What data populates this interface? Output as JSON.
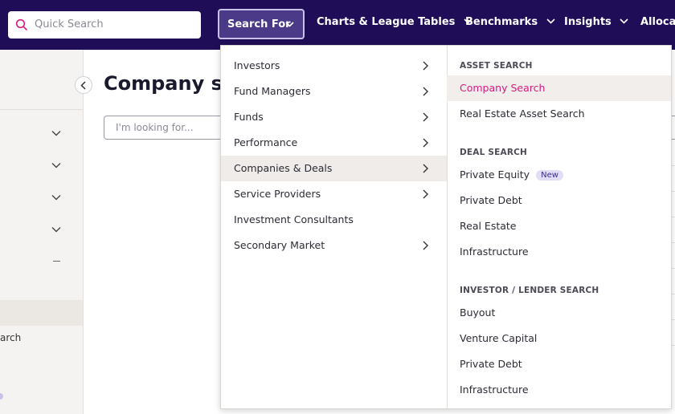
{
  "topbar": {
    "quick_search_placeholder": "Quick Search",
    "search_for_label": "Search For",
    "nav": [
      {
        "label": "Charts & League Tables"
      },
      {
        "label": "Benchmarks"
      },
      {
        "label": "Insights"
      },
      {
        "label": "Allocato"
      }
    ]
  },
  "page": {
    "title": "Company sea",
    "search_placeholder": "I'm looking for...",
    "sidebar_partial_label": "arch"
  },
  "dropdown": {
    "left": [
      {
        "label": "Investors",
        "has_arrow": true
      },
      {
        "label": "Fund Managers",
        "has_arrow": true
      },
      {
        "label": "Funds",
        "has_arrow": true
      },
      {
        "label": "Performance",
        "has_arrow": true
      },
      {
        "label": "Companies & Deals",
        "has_arrow": true,
        "active": true
      },
      {
        "label": "Service Providers",
        "has_arrow": true
      },
      {
        "label": "Investment Consultants",
        "has_arrow": false
      },
      {
        "label": "Secondary Market",
        "has_arrow": true
      }
    ],
    "sections": [
      {
        "heading": "ASSET SEARCH",
        "items": [
          {
            "label": "Company Search",
            "active": true
          },
          {
            "label": "Real Estate Asset Search"
          }
        ]
      },
      {
        "heading": "DEAL SEARCH",
        "items": [
          {
            "label": "Private Equity",
            "badge": "New"
          },
          {
            "label": "Private Debt"
          },
          {
            "label": "Real Estate"
          },
          {
            "label": "Infrastructure"
          }
        ]
      },
      {
        "heading": "INVESTOR / LENDER SEARCH",
        "items": [
          {
            "label": "Buyout"
          },
          {
            "label": "Venture Capital"
          },
          {
            "label": "Private Debt"
          },
          {
            "label": "Infrastructure"
          }
        ]
      }
    ]
  },
  "colors": {
    "topbar": "#1f0d57",
    "accent": "#d61c7c",
    "badge_bg": "#e1ddf7"
  }
}
